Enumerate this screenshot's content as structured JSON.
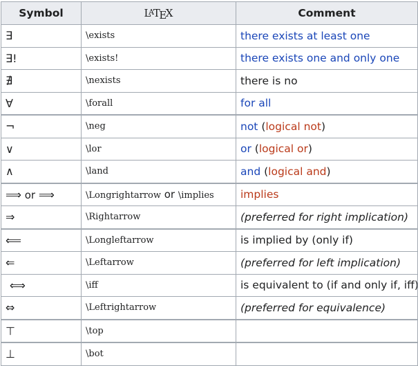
{
  "header": {
    "symbol": "Symbol",
    "latex_l": "L",
    "latex_a": "A",
    "latex_t": "T",
    "latex_e": "E",
    "latex_x": "X",
    "comment": "Comment"
  },
  "rows": [
    {
      "symbol": "∃",
      "latex": "\\exists",
      "comment": "there exists at least one"
    },
    {
      "symbol": "∃!",
      "latex": "\\exists!",
      "comment": "there exists one and only one"
    },
    {
      "symbol": "∄",
      "latex": "\\nexists",
      "comment": "there is no"
    },
    {
      "symbol": "∀",
      "latex": "\\forall",
      "comment": "for all"
    },
    {
      "symbol": "¬",
      "latex": "\\neg",
      "comment_a": "not",
      "comment_b": " (",
      "comment_c": "logical not",
      "comment_d": ")"
    },
    {
      "symbol": "∨",
      "latex": "\\lor",
      "comment_a": "or",
      "comment_b": " (",
      "comment_c": "logical or",
      "comment_d": ")"
    },
    {
      "symbol": "∧",
      "latex": "\\land",
      "comment_a": "and",
      "comment_b": " (",
      "comment_c": "logical and",
      "comment_d": ")"
    },
    {
      "symbol_a": "⟹",
      "symbol_or": " or ",
      "symbol_b": "⟹",
      "latex_a": "\\Longrightarrow",
      "latex_or": " or ",
      "latex_b": "\\implies",
      "comment": "implies"
    },
    {
      "symbol": "⇒",
      "latex": "\\Rightarrow",
      "comment": "(preferred for right implication)"
    },
    {
      "symbol": "⟸",
      "latex": "\\Longleftarrow",
      "comment": "is implied by (only if)"
    },
    {
      "symbol": "⇐",
      "latex": "\\Leftarrow",
      "comment": "(preferred for left implication)"
    },
    {
      "symbol": "⟺",
      "latex": "\\iff",
      "comment": "is equivalent to (if and only if, iff)"
    },
    {
      "symbol": "⇔",
      "latex": "\\Leftrightarrow",
      "comment": "(preferred for equivalence)"
    },
    {
      "symbol": "⊤",
      "latex": "\\top",
      "comment": ""
    },
    {
      "symbol": "⊥",
      "latex": "\\bot",
      "comment": ""
    }
  ],
  "colors": {
    "link_blue": "#1a46b8",
    "red_link": "#ba3a1a",
    "header_bg": "#eaecf0",
    "border": "#a2a9b1"
  }
}
